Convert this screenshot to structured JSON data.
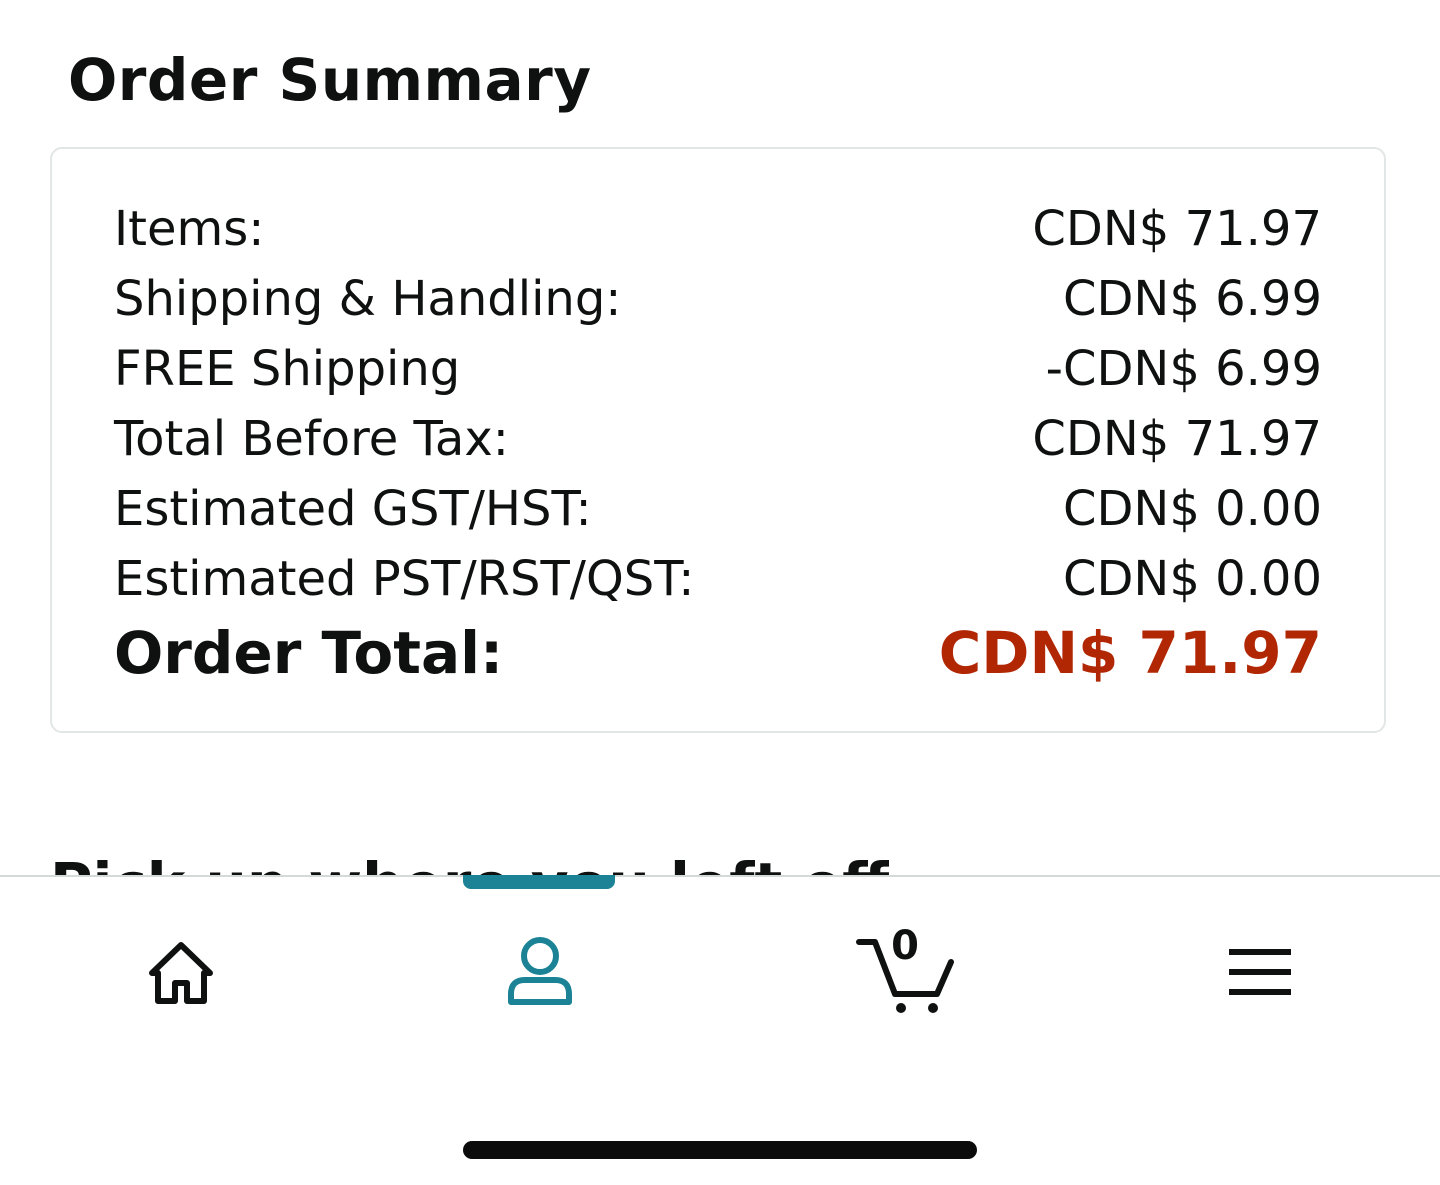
{
  "order_summary": {
    "heading": "Order Summary",
    "rows": [
      {
        "label": "Items:",
        "value": "CDN$ 71.97"
      },
      {
        "label": "Shipping & Handling:",
        "value": "CDN$ 6.99"
      },
      {
        "label": "FREE Shipping",
        "value": "-CDN$ 6.99"
      },
      {
        "label": "Total Before Tax:",
        "value": "CDN$ 71.97"
      },
      {
        "label": "Estimated GST/HST:",
        "value": "CDN$ 0.00"
      },
      {
        "label": "Estimated PST/RST/QST:",
        "value": "CDN$ 0.00"
      }
    ],
    "total": {
      "label": "Order Total:",
      "value": "CDN$ 71.97"
    }
  },
  "partial_section": {
    "heading_fragment": "Pick up where you left off"
  },
  "bottom_nav": {
    "active_tab": "account",
    "items": [
      {
        "id": "home",
        "icon": "home-icon"
      },
      {
        "id": "account",
        "icon": "person-icon"
      },
      {
        "id": "cart",
        "icon": "cart-icon",
        "count": "0"
      },
      {
        "id": "menu",
        "icon": "hamburger-menu-icon"
      }
    ]
  },
  "colors": {
    "accent_teal": "#1c8396",
    "price_red": "#b12704",
    "text": "#0f1111",
    "card_border": "#e3e6e6"
  }
}
